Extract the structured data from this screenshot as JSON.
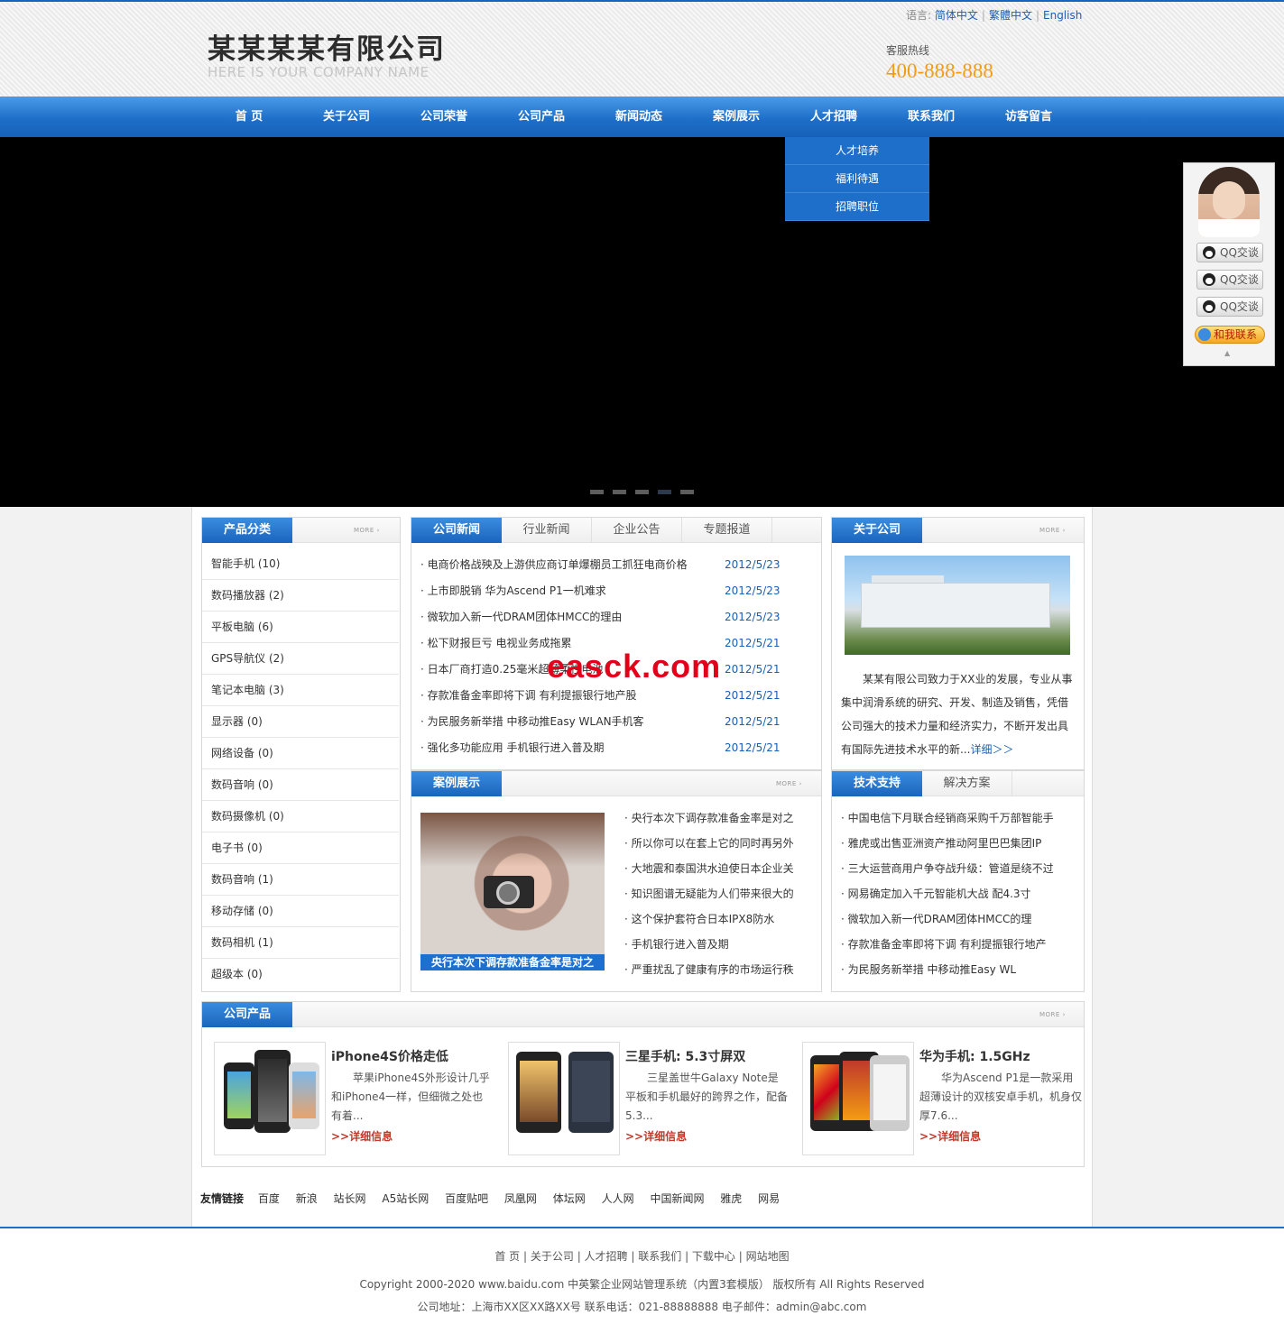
{
  "header": {
    "lang_label": "语言:",
    "languages": [
      "简体中文",
      "繁體中文",
      "English"
    ],
    "logo_main": "某某某某有限公司",
    "logo_sub": "HERE IS YOUR COMPANY NAME",
    "hotline_label": "客服热线",
    "hotline_number": "400-888-888"
  },
  "nav": {
    "items": [
      "首 页",
      "关于公司",
      "公司荣誉",
      "公司产品",
      "新闻动态",
      "案例展示",
      "人才招聘",
      "联系我们",
      "访客留言"
    ],
    "dropdown": [
      "人才培养",
      "福利待遇",
      "招聘职位"
    ]
  },
  "banner": {
    "slide_count": 5,
    "active_slide": 4
  },
  "qq_float": {
    "buttons": [
      "QQ交谈",
      "QQ交谈",
      "QQ交谈"
    ],
    "contact": "和我联系"
  },
  "categories": {
    "title": "产品分类",
    "more": "MORE",
    "items": [
      "智能手机 (10)",
      "数码播放器 (2)",
      "平板电脑 (6)",
      "GPS导航仪 (2)",
      "笔记本电脑 (3)",
      "显示器 (0)",
      "网络设备 (0)",
      "数码音响 (0)",
      "数码摄像机 (0)",
      "电子书 (0)",
      "数码音响 (1)",
      "移动存储 (0)",
      "数码相机 (1)",
      "超级本 (0)"
    ]
  },
  "news": {
    "tabs": [
      "公司新闻",
      "行业新闻",
      "企业公告",
      "专题报道"
    ],
    "items": [
      {
        "title": "· 电商价格战殃及上游供应商订单爆棚员工抓狂电商价格",
        "date": "2012/5/23"
      },
      {
        "title": "· 上市即脱销 华为Ascend P1一机难求",
        "date": "2012/5/23"
      },
      {
        "title": "· 微软加入新一代DRAM团体HMCC的理由",
        "date": "2012/5/23"
      },
      {
        "title": "· 松下财报巨亏 电视业务成拖累",
        "date": "2012/5/21"
      },
      {
        "title": "· 日本厂商打造0.25毫米超薄柔性电池",
        "date": "2012/5/21"
      },
      {
        "title": "· 存款准备金率即将下调 有利提振银行地产股",
        "date": "2012/5/21"
      },
      {
        "title": "· 为民服务新举措 中移动推Easy WLAN手机客",
        "date": "2012/5/21"
      },
      {
        "title": "· 强化多功能应用 手机银行进入普及期",
        "date": "2012/5/21"
      }
    ]
  },
  "about": {
    "title": "关于公司",
    "more": "MORE",
    "text": "某某有限公司致力于XX业的发展，专业从事集中润滑系统的研究、开发、制造及销售，凭借公司强大的技术力量和经济实力，不断开发出具有国际先进技术水平的新...",
    "detail": "详细＞＞"
  },
  "cases": {
    "title": "案例展示",
    "more": "MORE",
    "caption": "央行本次下调存款准备金率是对之",
    "items": [
      "· 央行本次下调存款准备金率是对之",
      "· 所以你可以在套上它的同时再另外",
      "· 大地震和泰国洪水迫使日本企业关",
      "· 知识图谱无疑能为人们带来很大的",
      "· 这个保护套符合日本IPX8防水",
      "· 手机银行进入普及期",
      "· 严重扰乱了健康有序的市场运行秩"
    ]
  },
  "tech": {
    "tabs": [
      "技术支持",
      "解决方案"
    ],
    "items": [
      "· 中国电信下月联合经销商采购千万部智能手",
      "· 雅虎或出售亚洲资产推动阿里巴巴集团IP",
      "· 三大运营商用户争夺战升级：管道是绕不过",
      "· 网易确定加入千元智能机大战 配4.3寸",
      "· 微软加入新一代DRAM团体HMCC的理",
      "· 存款准备金率即将下调 有利提振银行地产",
      "· 为民服务新举措 中移动推Easy WL"
    ]
  },
  "products": {
    "title": "公司产品",
    "more": "MORE",
    "items": [
      {
        "title": "iPhone4S价格走低",
        "desc": "苹果iPhone4S外形设计几乎和iPhone4一样，但细微之处也有着...",
        "link": ">>详细信息"
      },
      {
        "title": "三星手机: 5.3寸屏双",
        "desc": "三星盖世牛Galaxy Note是平板和手机最好的跨界之作，配备5.3...",
        "link": ">>详细信息"
      },
      {
        "title": "华为手机: 1.5GHz",
        "desc": "华为Ascend P1是一款采用超薄设计的双核安卓手机，机身仅厚7.6...",
        "link": ">>详细信息"
      }
    ]
  },
  "friend_links": {
    "label": "友情链接",
    "items": [
      "百度",
      "新浪",
      "站长网",
      "A5站长网",
      "百度贴吧",
      "凤凰网",
      "体坛网",
      "人人网",
      "中国新闻网",
      "雅虎",
      "网易"
    ]
  },
  "footer": {
    "nav": [
      "首 页",
      "关于公司",
      "人才招聘",
      "联系我们",
      "下载中心",
      "网站地图"
    ],
    "copyright": "Copyright 2000-2020 www.baidu.com 中英繁企业网站管理系统（内置3套模版） 版权所有 All Rights Reserved",
    "address": "公司地址：上海市XX区XX路XX号 联系电话：021-88888888 电子邮件：admin@abc.com"
  },
  "watermark": "easck.com",
  "colors": {
    "brand_blue": "#1e6fc9",
    "hotline": "#f39c12",
    "link_red": "#c0392b"
  }
}
